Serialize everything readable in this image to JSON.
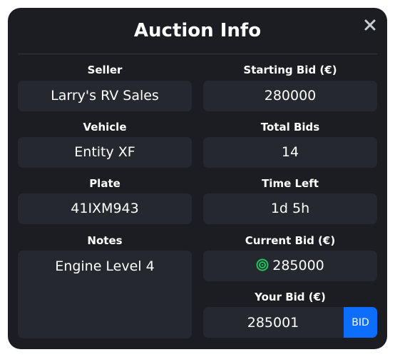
{
  "dialog": {
    "title": "Auction Info",
    "close_icon": "close-icon"
  },
  "fields": {
    "seller": {
      "label": "Seller",
      "value": "Larry's RV Sales"
    },
    "starting_bid": {
      "label": "Starting Bid (€)",
      "value": "280000"
    },
    "vehicle": {
      "label": "Vehicle",
      "value": "Entity XF"
    },
    "total_bids": {
      "label": "Total Bids",
      "value": "14"
    },
    "plate": {
      "label": "Plate",
      "value": "41IXM943"
    },
    "time_left": {
      "label": "Time Left",
      "value": "1d 5h"
    },
    "notes": {
      "label": "Notes",
      "value": "Engine Level 4"
    },
    "current_bid": {
      "label": "Current Bid (€)",
      "value": "285000",
      "icon": "target-icon",
      "icon_color": "#22c55e"
    },
    "your_bid": {
      "label": "Your Bid (€)",
      "value": "285001",
      "button_label": "BID"
    }
  },
  "colors": {
    "background": "#1b1d22",
    "field": "#25282e",
    "accent": "#0d6efd"
  }
}
